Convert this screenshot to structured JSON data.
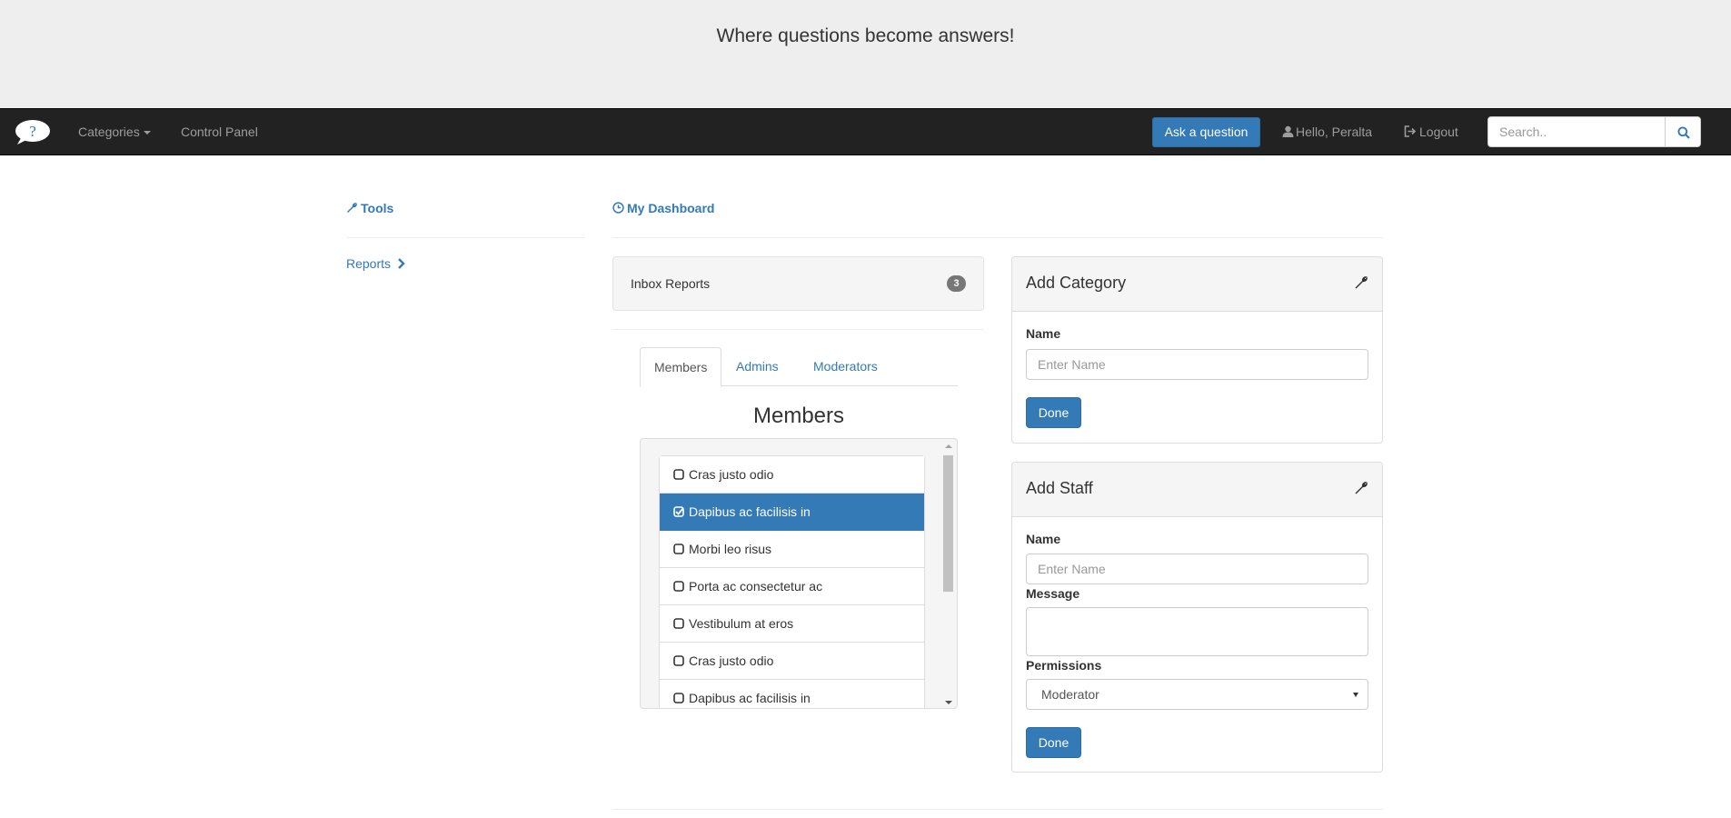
{
  "hero": {
    "tagline": "Where questions become answers!"
  },
  "navbar": {
    "brand_icon": "question-bubble-logo",
    "categories_label": "Categories",
    "control_panel_label": "Control Panel",
    "ask_label": "Ask a question",
    "user_label": "Hello, Peralta",
    "logout_label": "Logout",
    "search_placeholder": "Search.."
  },
  "sidebar": {
    "title": "Tools",
    "reports_label": "Reports"
  },
  "dashboard": {
    "title": "My Dashboard",
    "inbox": {
      "label": "Inbox Reports",
      "count": "3"
    },
    "tabs": [
      {
        "label": "Members",
        "active": true
      },
      {
        "label": "Admins",
        "active": false
      },
      {
        "label": "Moderators",
        "active": false
      }
    ],
    "members_heading": "Members",
    "members": [
      {
        "name": "Cras justo odio",
        "checked": false
      },
      {
        "name": "Dapibus ac facilisis in",
        "checked": true
      },
      {
        "name": "Morbi leo risus",
        "checked": false
      },
      {
        "name": "Porta ac consectetur ac",
        "checked": false
      },
      {
        "name": "Vestibulum at eros",
        "checked": false
      },
      {
        "name": "Cras justo odio",
        "checked": false
      },
      {
        "name": "Dapibus ac facilisis in",
        "checked": false
      }
    ]
  },
  "add_category": {
    "title": "Add Category",
    "name_label": "Name",
    "name_placeholder": "Enter Name",
    "done_label": "Done"
  },
  "add_staff": {
    "title": "Add Staff",
    "name_label": "Name",
    "name_placeholder": "Enter Name",
    "message_label": "Message",
    "permissions_label": "Permissions",
    "permission_value": "Moderator",
    "done_label": "Done"
  },
  "colors": {
    "primary": "#337ab7",
    "navbar": "#222222",
    "hero": "#eeeeee"
  }
}
